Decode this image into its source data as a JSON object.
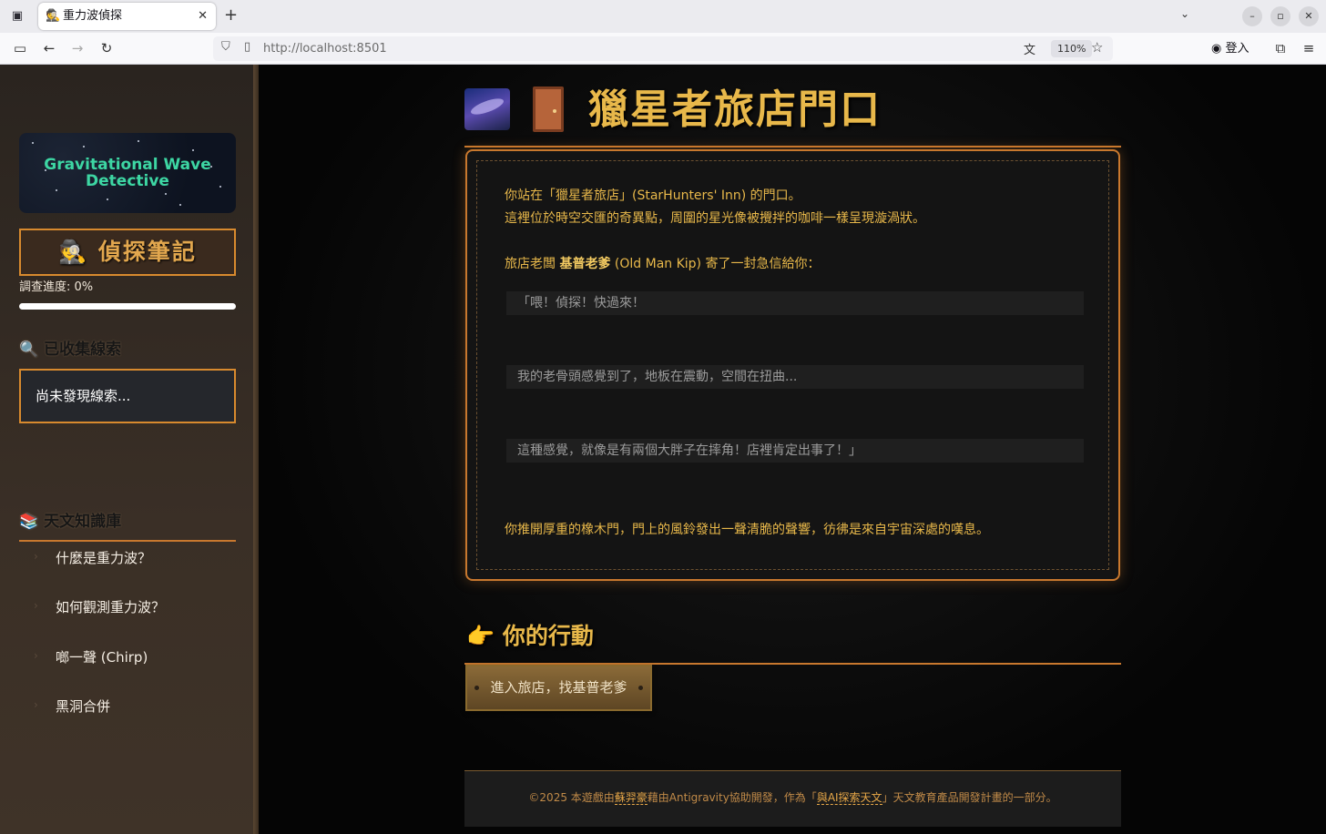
{
  "browser": {
    "tab_title": "重力波偵探",
    "tab_favicon": "🕵️",
    "url": "http://localhost:8501",
    "zoom": "110%",
    "login_label": "登入"
  },
  "sidebar": {
    "logo_line1": "Gravitational Wave",
    "logo_line2": "Detective",
    "notes_label": "🕵️ 偵探筆記",
    "progress_label": "調查進度: 0%",
    "progress_value": 0,
    "clues_heading": "🔍 已收集線索",
    "clues_empty": "尚未發現線索...",
    "knowledge_heading": "📚 天文知識庫",
    "knowledge_items": [
      {
        "label": "什麼是重力波？"
      },
      {
        "label": "如何觀測重力波？"
      },
      {
        "label": "啷一聲 (Chirp)"
      },
      {
        "label": "黑洞合併"
      }
    ]
  },
  "main": {
    "title": "獵星者旅店門口",
    "story": {
      "line1": "你站在「獵星者旅店」(StarHunters' Inn) 的門口。",
      "line2": "這裡位於時空交匯的奇異點，周圍的星光像被攪拌的咖啡一樣呈現漩渦狀。",
      "line3_pre": "旅店老闆 ",
      "line3_name": "基普老爹",
      "line3_post": " (Old Man Kip) 寄了一封急信給你：",
      "quotes": [
        "「喂！偵探！快過來！",
        "我的老骨頭感覺到了，地板在震動，空間在扭曲...",
        "這種感覺，就像是有兩個大胖子在摔角！店裡肯定出事了！」"
      ],
      "closing": "你推開厚重的橡木門，門上的風鈴發出一聲清脆的聲響，彷彿是來自宇宙深處的嘆息。"
    },
    "action_heading": "👉 你的行動",
    "action_button": "進入旅店，找基普老爹",
    "footer": {
      "pre": "©2025 本遊戲由",
      "author": "蘇羿豪",
      "mid": "藉由Antigravity協助開發，作為「",
      "project": "與AI探索天文",
      "post": "」天文教育產品開發計畫的一部分。"
    }
  },
  "colors": {
    "accent": "#c8782e",
    "gold_text": "#e8b84a",
    "logo_text": "#3dd6a3"
  }
}
